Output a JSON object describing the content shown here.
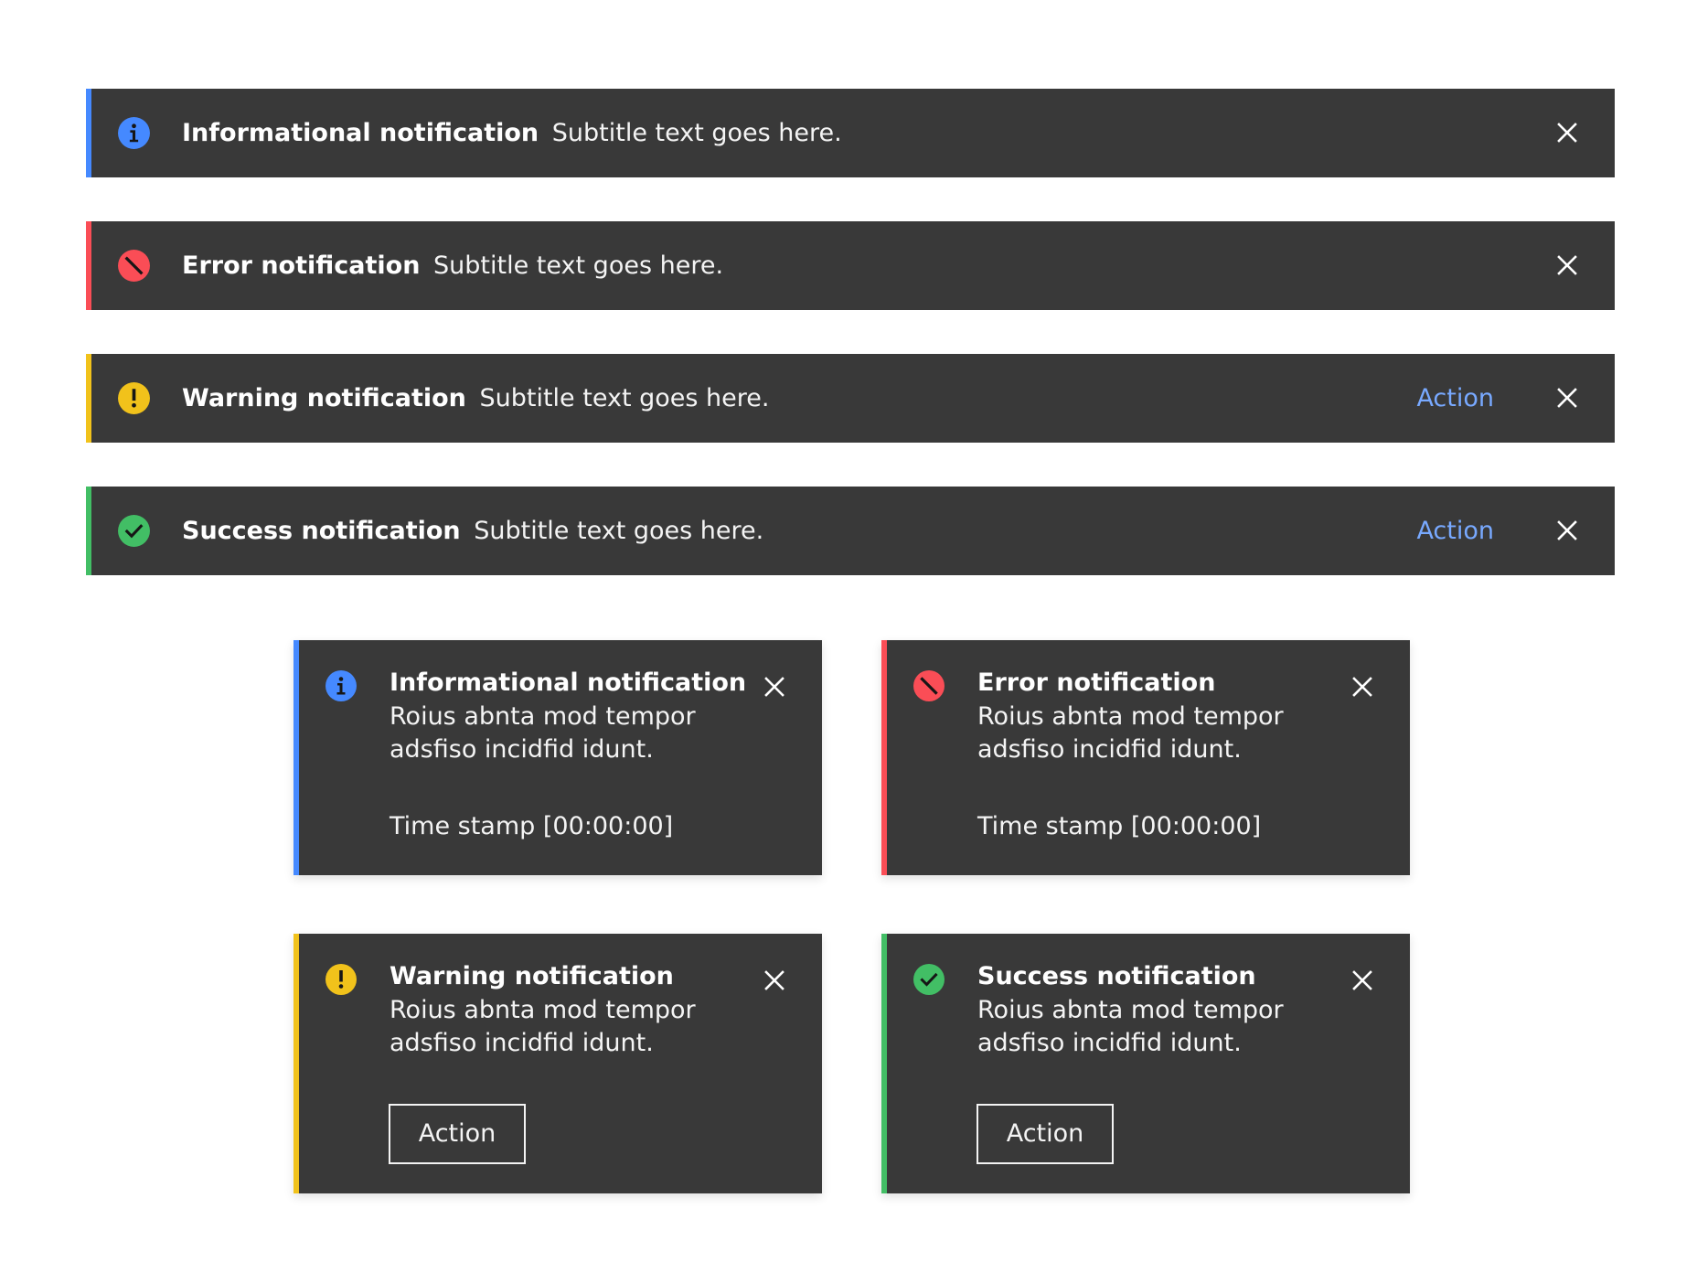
{
  "colors": {
    "info": "#4589ff",
    "error": "#fa4d56",
    "warning": "#f1c21b",
    "success": "#42be65",
    "surface": "#393939",
    "action_link": "#78a9ff"
  },
  "inline_notifications": [
    {
      "kind": "info",
      "icon": "info-icon",
      "title": "Informational notification",
      "subtitle": "Subtitle text goes here."
    },
    {
      "kind": "error",
      "icon": "error-icon",
      "title": "Error notification",
      "subtitle": "Subtitle text goes here."
    },
    {
      "kind": "warning",
      "icon": "warning-icon",
      "title": "Warning notification",
      "subtitle": "Subtitle text goes here.",
      "action": "Action"
    },
    {
      "kind": "success",
      "icon": "success-icon",
      "title": "Success notification",
      "subtitle": "Subtitle text goes here.",
      "action": "Action"
    }
  ],
  "toast_notifications": [
    {
      "kind": "info",
      "icon": "info-icon",
      "title": "Informational notification",
      "body": "Roius abnta mod tempor adsfiso incidfid idunt.",
      "timestamp": "Time stamp [00:00:00]"
    },
    {
      "kind": "error",
      "icon": "error-icon",
      "title": "Error notification",
      "body": "Roius abnta mod tempor adsfiso incidfid idunt.",
      "timestamp": "Time stamp [00:00:00]"
    },
    {
      "kind": "warning",
      "icon": "warning-icon",
      "title": "Warning notification",
      "body": "Roius abnta mod tempor adsfiso incidfid idunt.",
      "action": "Action"
    },
    {
      "kind": "success",
      "icon": "success-icon",
      "title": "Success notification",
      "body": "Roius abnta mod tempor adsfiso incidfid idunt.",
      "action": "Action"
    }
  ]
}
